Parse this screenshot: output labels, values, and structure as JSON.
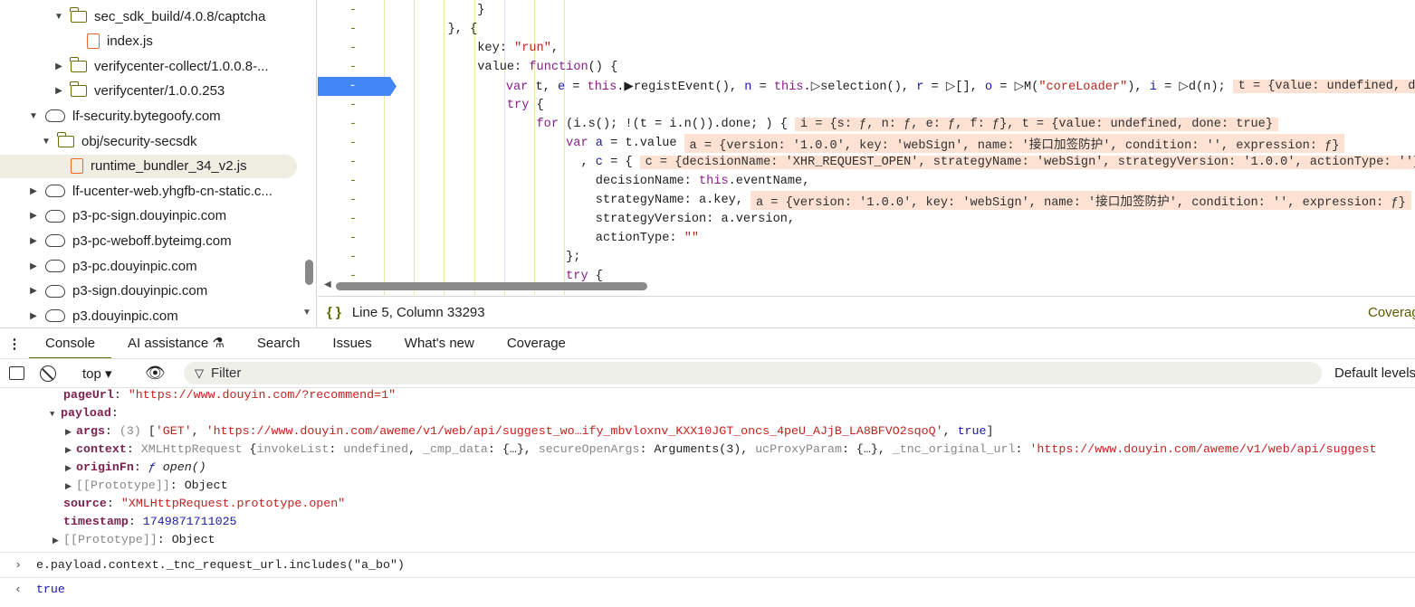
{
  "sidebar": {
    "items": [
      {
        "label": "sec_sdk_build/4.0.8/captcha",
        "type": "folder",
        "level": 3,
        "arrow": "▼"
      },
      {
        "label": "index.js",
        "type": "file",
        "level": 4,
        "arrow": ""
      },
      {
        "label": "verifycenter-collect/1.0.0.8-...",
        "type": "folder",
        "level": 3,
        "arrow": "▶"
      },
      {
        "label": "verifycenter/1.0.0.253",
        "type": "folder",
        "level": 3,
        "arrow": "▶"
      },
      {
        "label": "lf-security.bytegoofy.com",
        "type": "cloud",
        "level": 1,
        "arrow": "▼"
      },
      {
        "label": "obj/security-secsdk",
        "type": "folder",
        "level": 2,
        "arrow": "▼"
      },
      {
        "label": "runtime_bundler_34_v2.js",
        "type": "file",
        "level": 3,
        "arrow": "",
        "selected": true
      },
      {
        "label": "lf-ucenter-web.yhgfb-cn-static.c...",
        "type": "cloud",
        "level": 1,
        "arrow": "▶"
      },
      {
        "label": "p3-pc-sign.douyinpic.com",
        "type": "cloud",
        "level": 1,
        "arrow": "▶"
      },
      {
        "label": "p3-pc-weboff.byteimg.com",
        "type": "cloud",
        "level": 1,
        "arrow": "▶"
      },
      {
        "label": "p3-pc.douyinpic.com",
        "type": "cloud",
        "level": 1,
        "arrow": "▶"
      },
      {
        "label": "p3-sign.douyinpic.com",
        "type": "cloud",
        "level": 1,
        "arrow": "▶"
      },
      {
        "label": "p3.douyinpic.com",
        "type": "cloud",
        "level": 1,
        "arrow": "▶"
      }
    ]
  },
  "editor": {
    "lines": [
      {
        "g": "-",
        "segs": [
          [
            "pl",
            "        }"
          ]
        ]
      },
      {
        "g": "-",
        "segs": [
          [
            "pl",
            "    }, {"
          ]
        ]
      },
      {
        "g": "-",
        "segs": [
          [
            "pl",
            "        key: "
          ],
          [
            "str",
            "\"run\""
          ],
          [
            "pl",
            ","
          ]
        ]
      },
      {
        "g": "-",
        "segs": [
          [
            "pl",
            "        value: "
          ],
          [
            "kw",
            "function"
          ],
          [
            "pl",
            "() {"
          ]
        ]
      },
      {
        "g": "-",
        "bp": true,
        "segs": [
          [
            "kw",
            "            var "
          ],
          [
            "pl",
            "t, "
          ],
          [
            "vr",
            "e"
          ],
          [
            "pl",
            " = "
          ],
          [
            "kw",
            "this"
          ],
          [
            "pl",
            ".▶registEvent(), "
          ],
          [
            "vr",
            "n"
          ],
          [
            "pl",
            " = "
          ],
          [
            "kw",
            "this"
          ],
          [
            "pl",
            ".▷selection(), "
          ],
          [
            "vr",
            "r"
          ],
          [
            "pl",
            " = ▷[], "
          ],
          [
            "vr",
            "o"
          ],
          [
            "pl",
            " = ▷M("
          ],
          [
            "str",
            "\"coreLoader\""
          ],
          [
            "pl",
            "), "
          ],
          [
            "vr",
            "i"
          ],
          [
            "pl",
            " = ▷d(n);"
          ]
        ],
        "ann": "t = {value: undefined, done: true}"
      },
      {
        "g": "-",
        "segs": [
          [
            "kw",
            "            try"
          ],
          [
            "pl",
            " {"
          ]
        ]
      },
      {
        "g": "-",
        "segs": [
          [
            "kw",
            "                for"
          ],
          [
            "pl",
            " (i.s(); !(t = i.n()).done; ) {"
          ]
        ],
        "ann": "i = {s: ƒ, n: ƒ, e: ƒ, f: ƒ}, t = {value: undefined, done: true}"
      },
      {
        "g": "-",
        "segs": [
          [
            "kw",
            "                    var "
          ],
          [
            "vr",
            "a"
          ],
          [
            "pl",
            " = t.value"
          ]
        ],
        "ann": "a = {version: '1.0.0', key: 'webSign', name: '接口加签防护', condition: '', expression: ƒ}"
      },
      {
        "g": "-",
        "segs": [
          [
            "pl",
            "                      , "
          ],
          [
            "vr",
            "c"
          ],
          [
            "pl",
            " = {"
          ]
        ],
        "ann": "c = {decisionName: 'XHR_REQUEST_OPEN', strategyName: 'webSign', strategyVersion: '1.0.0', actionType: ''}"
      },
      {
        "g": "-",
        "segs": [
          [
            "pl",
            "                        decisionName: "
          ],
          [
            "kw",
            "this"
          ],
          [
            "pl",
            ".eventName,"
          ]
        ]
      },
      {
        "g": "-",
        "segs": [
          [
            "pl",
            "                        strategyName: a.key,"
          ]
        ],
        "ann": "a = {version: '1.0.0', key: 'webSign', name: '接口加签防护', condition: '', expression: ƒ}"
      },
      {
        "g": "-",
        "segs": [
          [
            "pl",
            "                        strategyVersion: a.version,"
          ]
        ]
      },
      {
        "g": "-",
        "segs": [
          [
            "pl",
            "                        actionType: "
          ],
          [
            "str",
            "\"\""
          ]
        ]
      },
      {
        "g": "-",
        "segs": [
          [
            "pl",
            "                    };"
          ]
        ]
      },
      {
        "g": "-",
        "segs": [
          [
            "kw",
            "                    try"
          ],
          [
            "pl",
            " {"
          ]
        ]
      }
    ]
  },
  "status": {
    "icon": "{ }",
    "position": "Line 5, Column 33293",
    "right": "Coverage"
  },
  "tabs": [
    "Console",
    "AI assistance",
    "Search",
    "Issues",
    "What's new",
    "Coverage"
  ],
  "toolbar": {
    "context": "top",
    "filter_placeholder": "Filter",
    "levels": "Default levels"
  },
  "console": {
    "pageUrl_key": "pageUrl",
    "pageUrl": "\"https://www.douyin.com/?recommend=1\"",
    "payload_key": "payload",
    "args_key": "args",
    "args_count": "(3)",
    "args_val1": "'GET'",
    "args_val2": "'https://www.douyin.com/aweme/v1/web/api/suggest_wo…ify_mbvloxnv_KXX10JGT_oncs_4peU_AJjB_LA8BFVO2sqoQ'",
    "args_val3": "true",
    "context_key": "context",
    "context_type": "XMLHttpRequest",
    "context_p1": "invokeList",
    "context_v1": "undefined",
    "context_p2": "_cmp_data",
    "context_p3": "secureOpenArgs",
    "context_v3": "Arguments(3)",
    "context_p4": "ucProxyParam",
    "context_p5": "_tnc_original_url",
    "context_v5": "'https://www.douyin.com/aweme/v1/web/api/suggest",
    "originFn_key": "originFn",
    "originFn_val": "open()",
    "proto_key": "[[Prototype]]",
    "proto_val": "Object",
    "source_key": "source",
    "source_val": "\"XMLHttpRequest.prototype.open\"",
    "timestamp_key": "timestamp",
    "timestamp_val": "1749871711025",
    "input": "e.payload.context._tnc_request_url.includes(\"a_bo\")",
    "result": "true"
  }
}
